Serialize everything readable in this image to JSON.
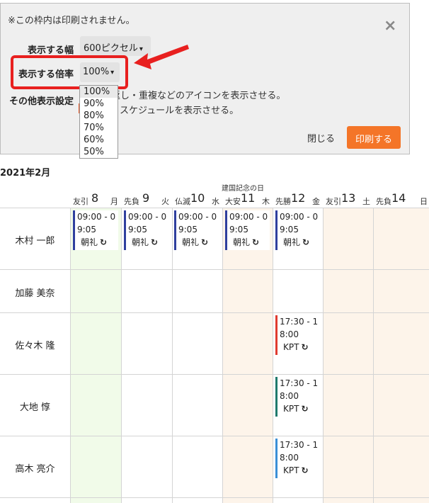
{
  "panel": {
    "notice": "※この枠内は印刷されません。",
    "close_icon": "×",
    "width_label": "表示する幅",
    "width_value": "600ピクセル",
    "scale_label": "表示する倍率",
    "scale_value": "100%",
    "scale_options": [
      "100%",
      "90%",
      "80%",
      "70%",
      "60%",
      "50%"
    ],
    "other_label": "その他表示設定",
    "option1_text": "返し・重複などのアイコンを表示させる。",
    "option2_text": "スケジュールを表示させる。",
    "close_button": "閉じる",
    "print_button": "印刷する",
    "accent_color": "#f47528",
    "highlight_color": "#e8201f"
  },
  "calendar": {
    "month": "2021年2月",
    "holiday_note": "建国記念の日",
    "days": [
      {
        "rokuyo": "友引",
        "day": "8",
        "dow": "月"
      },
      {
        "rokuyo": "先負",
        "day": "9",
        "dow": "火"
      },
      {
        "rokuyo": "仏滅",
        "day": "10",
        "dow": "水"
      },
      {
        "rokuyo": "大安",
        "day": "11",
        "dow": "木"
      },
      {
        "rokuyo": "先勝",
        "day": "12",
        "dow": "金"
      },
      {
        "rokuyo": "友引",
        "day": "13",
        "dow": "土"
      },
      {
        "rokuyo": "先負",
        "day": "14",
        "dow": "日"
      }
    ],
    "people": [
      "木村 一郎",
      "加藤 美奈",
      "佐々木 隆",
      "大地 惇",
      "高木 亮介"
    ],
    "events": [
      {
        "line1": "09:00 - 0",
        "line2": "9:05",
        "title": "朝礼",
        "icon": "repeat-icon",
        "color": "#2f3f9e"
      },
      {
        "line1": "17:30 - 1",
        "line2": "8:00",
        "title": "KPT",
        "icon": "repeat-icon",
        "color_sasaki": "#e03a2f",
        "color_daichi": "#1f7a6c",
        "color_takagi": "#3a8fd6"
      }
    ],
    "colors": {
      "today": "#f1fbe9",
      "weekend": "#fdf4ea"
    }
  }
}
